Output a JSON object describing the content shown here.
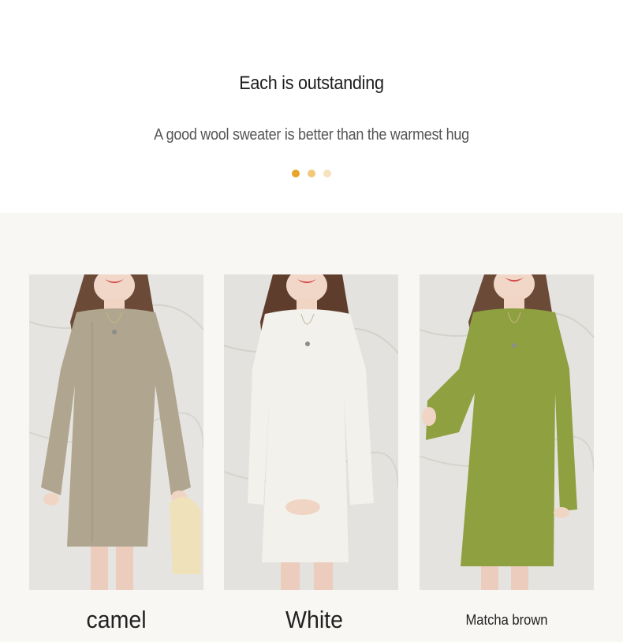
{
  "header": {
    "title": "Each is outstanding",
    "subtitle": "A good wool sweater is better than the warmest hug"
  },
  "carousel": {
    "dots": [
      {
        "color": "#e7a52c",
        "active": true
      },
      {
        "color": "#f2c97a",
        "active": false
      },
      {
        "color": "#f7e2bd",
        "active": false
      }
    ]
  },
  "products": [
    {
      "label": "camel",
      "dress_color": "#b0a58f",
      "icon": "dress-photo-camel"
    },
    {
      "label": "White",
      "dress_color": "#f3f1ec",
      "icon": "dress-photo-white"
    },
    {
      "label": "Matcha brown",
      "dress_color": "#8ea040",
      "icon": "dress-photo-matcha"
    }
  ]
}
